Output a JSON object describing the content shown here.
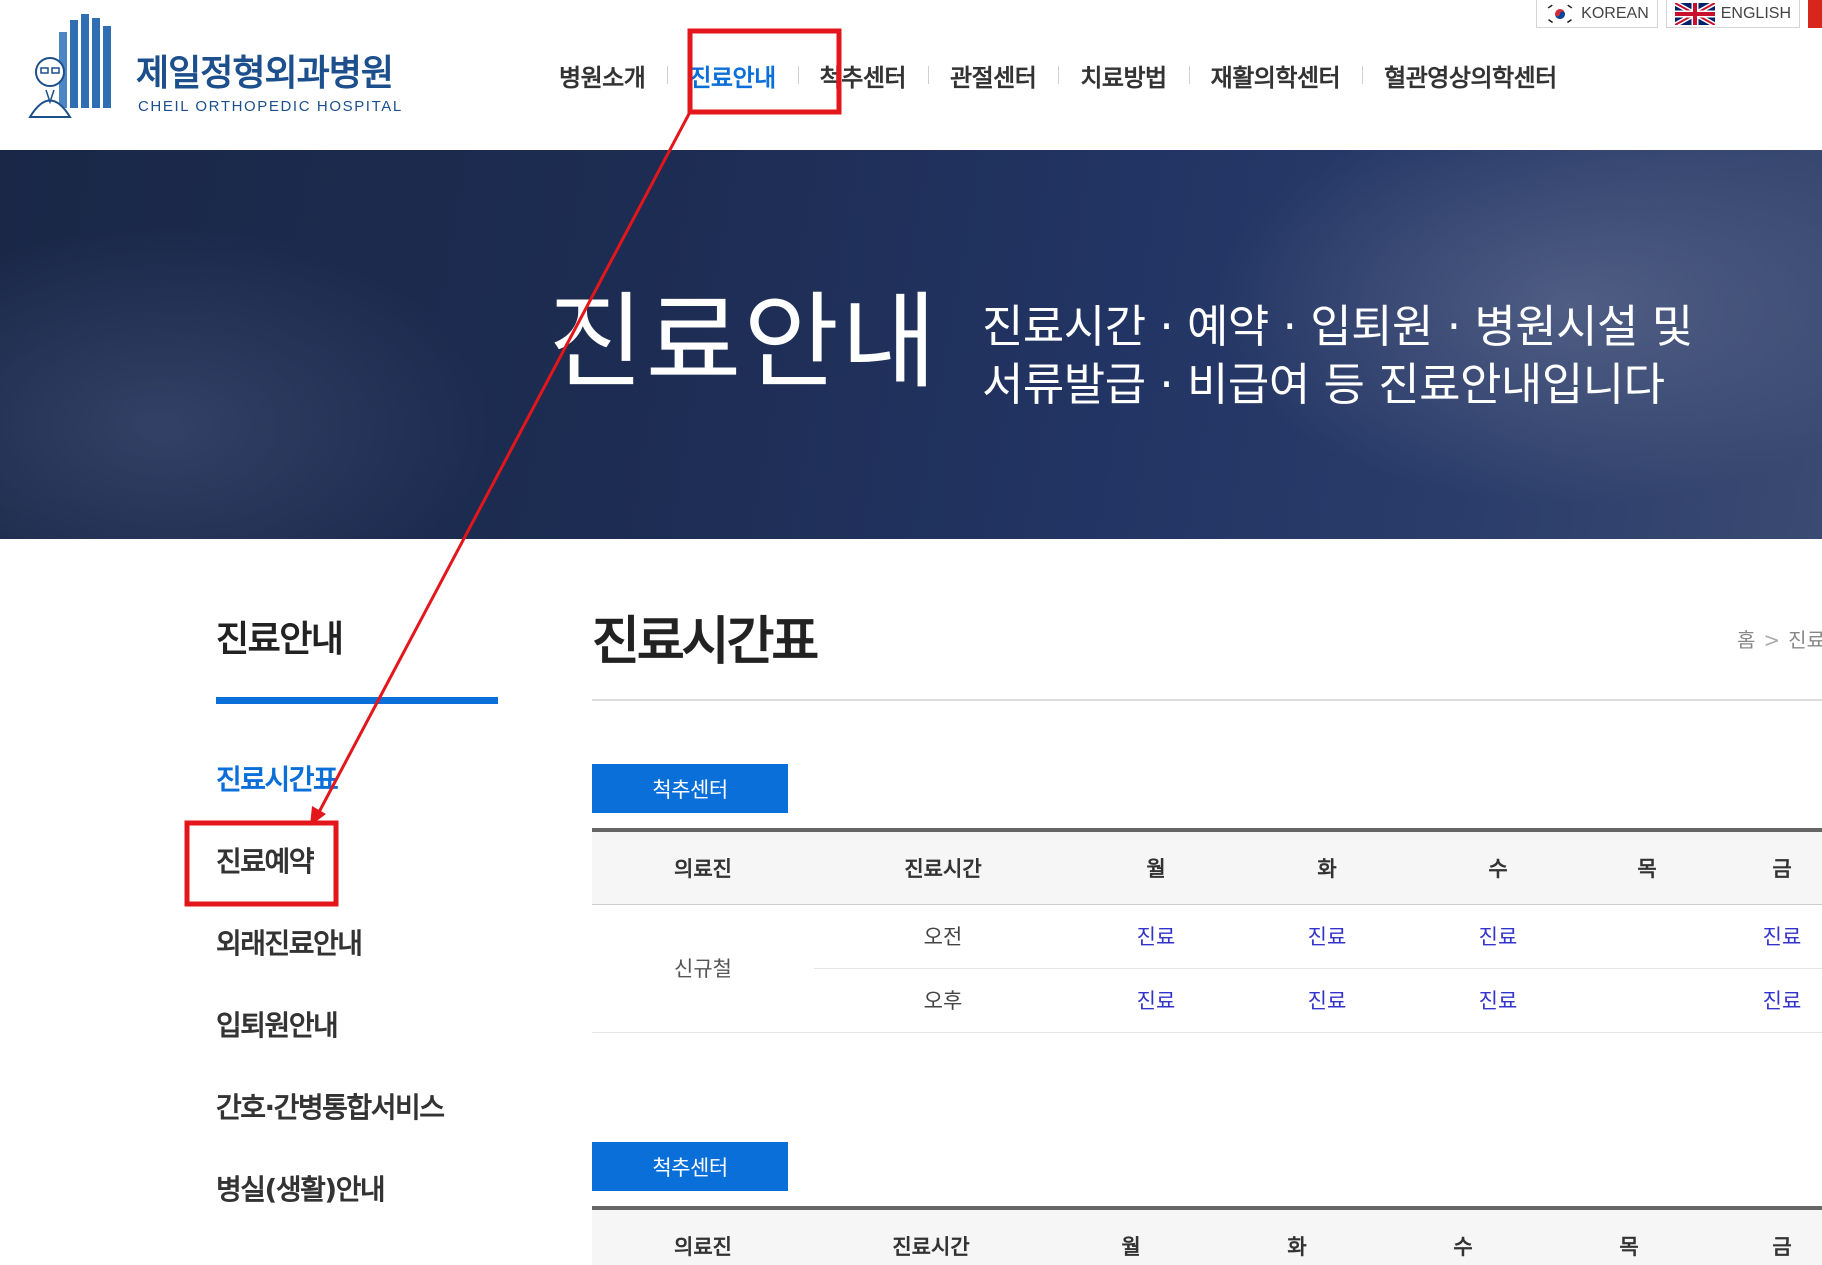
{
  "header": {
    "logo_kr": "제일정형외과병원",
    "logo_en": "CHEIL ORTHOPEDIC HOSPITAL",
    "languages": [
      {
        "label": "KOREAN",
        "icon": "korea-flag-icon"
      },
      {
        "label": "ENGLISH",
        "icon": "uk-flag-icon"
      }
    ],
    "nav": [
      {
        "label": "병원소개",
        "active": false
      },
      {
        "label": "진료안내",
        "active": true
      },
      {
        "label": "척추센터",
        "active": false
      },
      {
        "label": "관절센터",
        "active": false
      },
      {
        "label": "치료방법",
        "active": false
      },
      {
        "label": "재활의학센터",
        "active": false
      },
      {
        "label": "혈관영상의학센터",
        "active": false
      }
    ]
  },
  "banner": {
    "title": "진료안내",
    "subtitle_line1": "진료시간 · 예약 · 입퇴원 · 병원시설 및",
    "subtitle_line2": "서류발급 · 비급여 등 진료안내입니다"
  },
  "sidebar": {
    "title": "진료안내",
    "items": [
      {
        "label": "진료시간표",
        "active": true
      },
      {
        "label": "진료예약",
        "active": false
      },
      {
        "label": "외래진료안내",
        "active": false
      },
      {
        "label": "입퇴원안내",
        "active": false
      },
      {
        "label": "간호·간병통합서비스",
        "active": false
      },
      {
        "label": "병실(생활)안내",
        "active": false
      }
    ]
  },
  "content": {
    "page_title": "진료시간표",
    "breadcrumb": [
      "홈",
      "진료"
    ],
    "sections": [
      {
        "tag": "척추센터",
        "headers": [
          "의료진",
          "진료시간",
          "월",
          "화",
          "수",
          "목",
          "금"
        ],
        "doctor": "신규철",
        "rows": [
          {
            "time": "오전",
            "cells": [
              "진료",
              "진료",
              "진료",
              "",
              "진료"
            ]
          },
          {
            "time": "오후",
            "cells": [
              "진료",
              "진료",
              "진료",
              "",
              "진료"
            ]
          }
        ]
      },
      {
        "tag": "척추센터",
        "headers": [
          "의료진",
          "진료시간",
          "월",
          "화",
          "수",
          "목",
          "금"
        ]
      }
    ]
  },
  "colors": {
    "accent": "#0a6fd8",
    "annotation": "#e3161b",
    "schedule_on": "#3333cc",
    "banner": "#1d2c52"
  }
}
